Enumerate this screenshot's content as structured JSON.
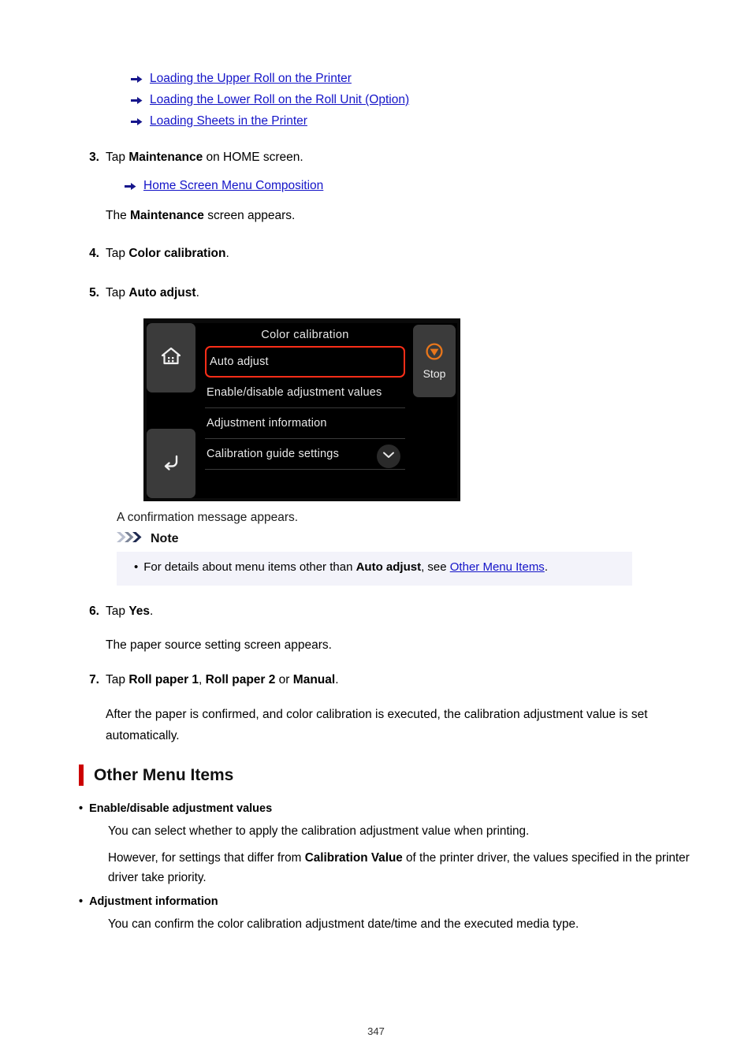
{
  "top_links": [
    {
      "icon": "arrow-right-icon",
      "label": "Loading the Upper Roll on the Printer"
    },
    {
      "icon": "arrow-right-icon",
      "label": "Loading the Lower Roll on the Roll Unit (Option)"
    },
    {
      "icon": "arrow-right-icon",
      "label": "Loading Sheets in the Printer"
    }
  ],
  "steps": {
    "step3": {
      "number": "3.",
      "text_before": "Tap ",
      "bold1": "Maintenance",
      "text_after": " on HOME screen.",
      "link": "Home Screen Menu Composition",
      "result_before": "The ",
      "result_bold": "Maintenance",
      "result_after": " screen appears."
    },
    "step4": {
      "number": "4.",
      "text_before": "Tap ",
      "bold1": "Color calibration",
      "text_after": "."
    },
    "step5": {
      "number": "5.",
      "text_before": "Tap ",
      "bold1": "Auto adjust",
      "text_after": "."
    },
    "step6": {
      "number": "6.",
      "text_before": "Tap ",
      "bold1": "Yes",
      "text_after": ".",
      "result": "The paper source setting screen appears."
    },
    "step7": {
      "number": "7.",
      "text_before": "Tap ",
      "bold1": "Roll paper 1",
      "sep1": ", ",
      "bold2": "Roll paper 2",
      "sep2": " or ",
      "bold3": "Manual",
      "text_after": ".",
      "result": "After the paper is confirmed, and color calibration is executed, the calibration adjustment value is set automatically."
    }
  },
  "lcd": {
    "title": "Color calibration",
    "home_icon": "home-icon",
    "back_icon": "back-arrow-icon",
    "stop_icon": "stop-icon",
    "stop_label": "Stop",
    "scroll_icon": "chevron-down-icon",
    "menu_items": [
      {
        "label": "Auto adjust",
        "selected": true
      },
      {
        "label": "Enable/disable adjustment values",
        "selected": false
      },
      {
        "label": "Adjustment information",
        "selected": false
      },
      {
        "label": "Calibration guide settings",
        "selected": false
      }
    ],
    "highlight_color": "#ff2e18",
    "accent_color": "#e8761b"
  },
  "confirmation_text": "A confirmation message appears.",
  "note": {
    "icon": "note-chevrons-icon",
    "title": "Note",
    "bullet_char": "•",
    "text_before": "For details about menu items other than ",
    "bold": "Auto adjust",
    "text_mid": ", see ",
    "link": "Other Menu Items",
    "text_after": ".",
    "background": "#f3f3fa"
  },
  "section": {
    "bar_color": "#cc0000",
    "title": "Other Menu Items",
    "items": [
      {
        "bullet": "•",
        "heading": "Enable/disable adjustment values",
        "paragraphs": [
          {
            "text": "You can select whether to apply the calibration adjustment value when printing."
          },
          {
            "text_before": "However, for settings that differ from ",
            "bold": "Calibration Value",
            "text_after": " of the printer driver, the values specified in the printer driver take priority."
          }
        ]
      },
      {
        "bullet": "•",
        "heading": "Adjustment information",
        "paragraphs": [
          {
            "text": "You can confirm the color calibration adjustment date/time and the executed media type."
          }
        ]
      }
    ]
  },
  "footer": {
    "page_number": "347"
  }
}
